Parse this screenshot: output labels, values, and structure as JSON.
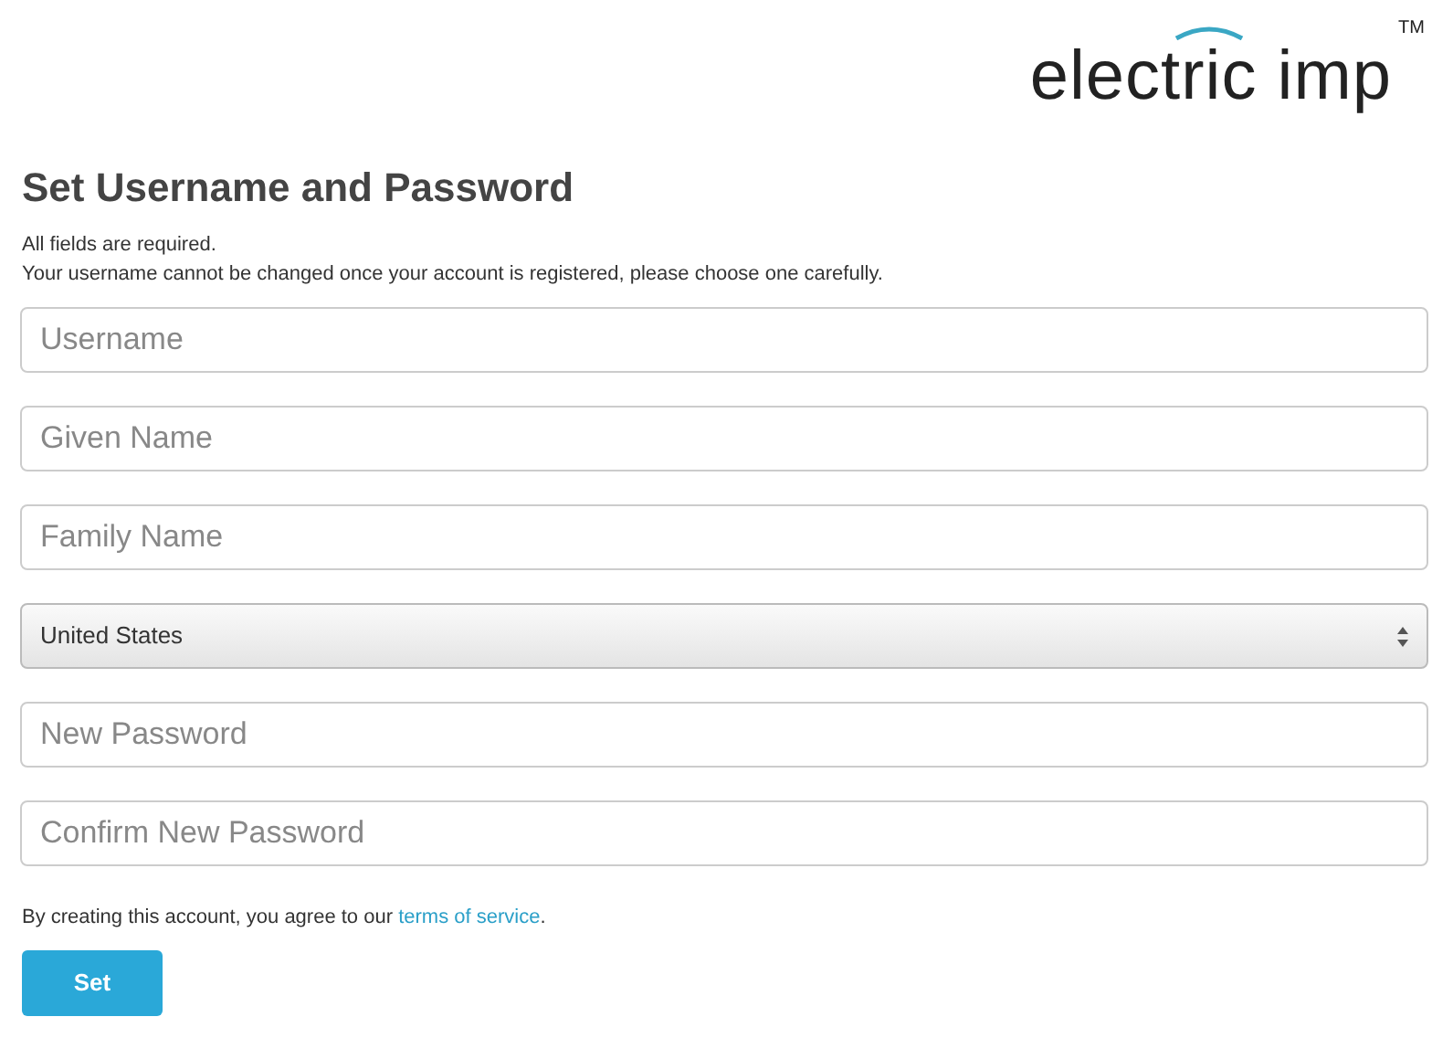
{
  "logo": {
    "text": "electric imp",
    "trademark": "TM"
  },
  "heading": "Set Username and Password",
  "notes": [
    "All fields are required.",
    "Your username cannot be changed once your account is registered, please choose one carefully."
  ],
  "fields": [
    {
      "kind": "text",
      "placeholder": "Username"
    },
    {
      "kind": "text",
      "placeholder": "Given Name"
    },
    {
      "kind": "text",
      "placeholder": "Family Name"
    },
    {
      "kind": "select",
      "value": "United States"
    },
    {
      "kind": "text",
      "placeholder": "New Password"
    },
    {
      "kind": "text",
      "placeholder": "Confirm New Password"
    }
  ],
  "agreement": {
    "before": "By creating this account, you agree to our ",
    "link": "terms of service",
    "after": "."
  },
  "submit": "Set"
}
